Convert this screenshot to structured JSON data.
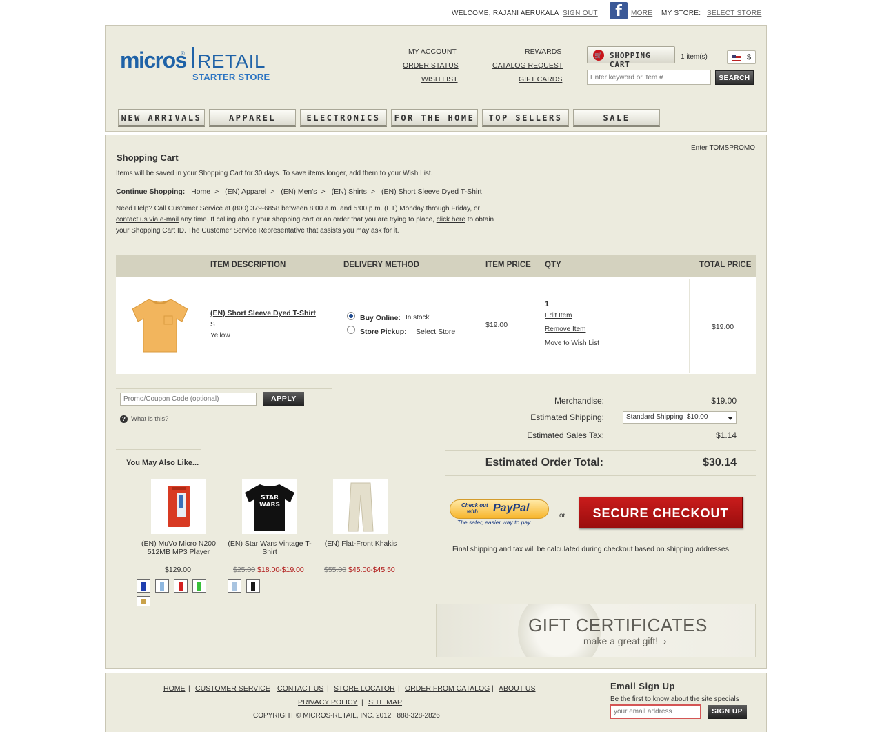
{
  "util": {
    "welcome": "WELCOME, RAJANI AERUKALA",
    "sign_out": "SIGN OUT",
    "fb_glyph": "f",
    "more": "MORE",
    "my_store": "MY STORE:",
    "select_store": "SELECT STORE"
  },
  "logo": {
    "micros": "micros",
    "reg": "®",
    "retail": "RETAIL",
    "sub": "STARTER STORE"
  },
  "header_links": {
    "my_account": "MY ACCOUNT",
    "order_status": "ORDER STATUS",
    "wish_list": "WISH LIST",
    "rewards": "REWARDS",
    "catalog_request": "CATALOG REQUEST",
    "gift_cards": "GIFT CARDS"
  },
  "cart_button": {
    "label": "SHOPPING CART",
    "icon": "cart-icon",
    "count": "1 item(s)"
  },
  "currency": {
    "symbol": "$",
    "flag": "us-flag-icon"
  },
  "search": {
    "placeholder": "Enter keyword or item #",
    "button": "SEARCH"
  },
  "nav": [
    "NEW ARRIVALS",
    "APPAREL",
    "ELECTRONICS",
    "FOR THE HOME",
    "TOP SELLERS",
    "SALE"
  ],
  "cart": {
    "promo_hint": "Enter TOMSPROMO",
    "title": "Shopping Cart",
    "save_note": "Items will be saved in your Shopping Cart for 30 days. To save items longer, add them to your Wish List.",
    "continue_label": "Continue Shopping:",
    "breadcrumb": [
      "Home",
      "(EN) Apparel",
      "(EN) Men's",
      "(EN) Shirts",
      "(EN) Short Sleeve Dyed T-Shirt"
    ],
    "breadcrumb_sep": ">",
    "help_1": "Need Help?  Call Customer Service at (800) 379-6858 between 8:00 a.m. and 5:00 p.m. (ET) Monday through Friday, or",
    "help_link1": "contact us via e-mail",
    "help_2": " any time. If calling about your shopping cart or an order that you are trying to place, ",
    "help_link2": "click here",
    "help_3": " to obtain",
    "help_4": "your Shopping Cart ID. The Customer Service Representative that assists you may ask for it.",
    "columns": {
      "description": "ITEM DESCRIPTION",
      "delivery": "DELIVERY METHOD",
      "price": "ITEM PRICE",
      "qty": "QTY",
      "total": "TOTAL PRICE"
    },
    "item": {
      "name": "(EN) Short Sleeve Dyed T-Shirt",
      "size": "S",
      "color": "Yellow",
      "delivery_online": "Buy Online:",
      "delivery_online_status": "In stock",
      "delivery_pickup": "Store Pickup:",
      "delivery_pickup_link": "Select Store",
      "delivery_selected": "online",
      "price": "$19.00",
      "qty": "1",
      "edit": "Edit Item",
      "remove": "Remove Item",
      "move": "Move to Wish List",
      "total": "$19.00"
    }
  },
  "promo": {
    "placeholder": "Promo/Coupon Code (optional)",
    "apply": "APPLY",
    "what": "What is this?",
    "help_icon": "?"
  },
  "totals": {
    "merch_label": "Merchandise:",
    "merch_value": "$19.00",
    "ship_label": "Estimated Shipping:",
    "ship_option": "Standard Shipping  $10.00",
    "tax_label": "Estimated Sales Tax:",
    "tax_value": "$1.14",
    "grand_label": "Estimated Order Total:",
    "grand_value": "$30.14"
  },
  "checkout": {
    "paypal_check": "Check out",
    "paypal_with": "with",
    "paypal_brand": "PayPal",
    "paypal_tag": "The safer, easier way to pay",
    "or": "or",
    "secure": "SECURE CHECKOUT",
    "final_note": "Final shipping and tax will be calculated during checkout based on shipping addresses."
  },
  "suggestions": {
    "title": "You May Also Like...",
    "products": [
      {
        "name": "(EN) MuVo Micro N200 512MB MP3 Player",
        "price": "$129.00",
        "old_price": "",
        "sale_price": "",
        "swatches": [
          "#1f3fb0",
          "#8fb8e0",
          "#d42020",
          "#39c039",
          "#c9a24a"
        ]
      },
      {
        "name": "(EN) Star Wars Vintage T-Shirt",
        "price": "",
        "old_price": "$25.00",
        "sale_price": "$18.00-$19.00",
        "swatches": [
          "#a9c4e0",
          "#1a1a1a"
        ]
      },
      {
        "name": "(EN) Flat-Front Khakis",
        "price": "",
        "old_price": "$55.00",
        "sale_price": "$45.00-$45.50",
        "swatches": []
      }
    ]
  },
  "gift": {
    "title": "GIFT CERTIFICATES",
    "sub": "make a great gift!",
    "arrow": "›"
  },
  "footer": {
    "links1": [
      "HOME",
      "CUSTOMER SERVICE",
      "CONTACT US",
      "STORE LOCATOR",
      "ORDER FROM CATALOG",
      "ABOUT US"
    ],
    "links2": [
      "PRIVACY POLICY",
      "SITE MAP"
    ],
    "sep": "|",
    "copyright": "COPYRIGHT © MICROS-RETAIL, INC. 2012 | 888-328-2826",
    "email_title": "Email Sign Up",
    "email_sub": "Be the first to know about the site specials",
    "email_placeholder": "your email address",
    "email_button": "SIGN UP"
  }
}
